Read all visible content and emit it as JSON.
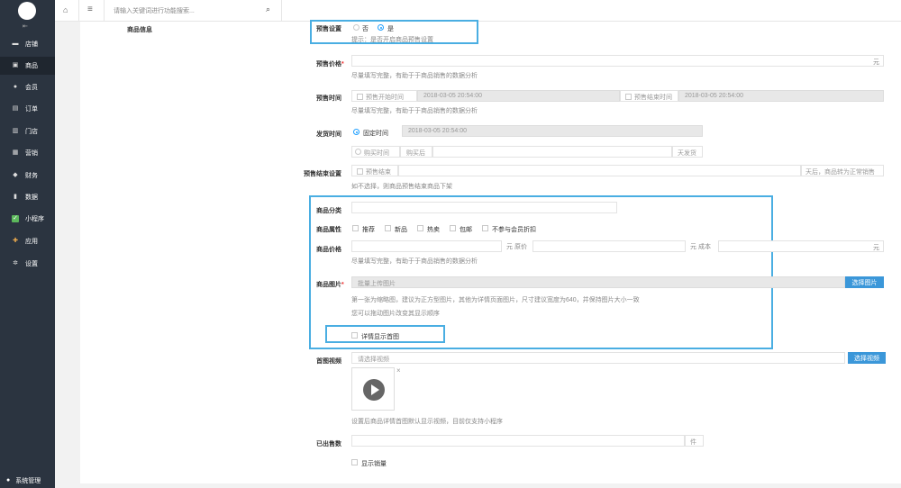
{
  "sidebar": {
    "collapse_glyph": "⇤",
    "items": [
      {
        "label": "店铺",
        "icon": "store-icon"
      },
      {
        "label": "商品",
        "icon": "goods-icon"
      },
      {
        "label": "会员",
        "icon": "member-icon"
      },
      {
        "label": "订单",
        "icon": "order-icon"
      },
      {
        "label": "门店",
        "icon": "shop-icon"
      },
      {
        "label": "营销",
        "icon": "marketing-icon"
      },
      {
        "label": "财务",
        "icon": "finance-icon"
      },
      {
        "label": "数据",
        "icon": "data-icon"
      },
      {
        "label": "小程序",
        "icon": "miniprogram-icon"
      },
      {
        "label": "应用",
        "icon": "apps-icon"
      },
      {
        "label": "设置",
        "icon": "gear-icon"
      }
    ],
    "system_label": "系统管理"
  },
  "topbar": {
    "search_placeholder": "请输入关键词进行功能搜索..."
  },
  "form": {
    "section_label": "商品信息",
    "presale": {
      "label": "预售设置",
      "opt_no": "否",
      "opt_yes": "是",
      "hint": "提示：是否开启商品预售设置"
    },
    "presale_price": {
      "label": "预售价格",
      "suffix": "元",
      "hint": "尽量填写完整，有助于于商品销售的数据分析"
    },
    "presale_time": {
      "label": "预售时间",
      "start_label": "预售开始时间",
      "start_value": "2018-03-05 20:54:00",
      "end_label": "预售结束时间",
      "end_value": "2018-03-05 20:54:00",
      "hint": "尽量填写完整，有助于于商品销售的数据分析"
    },
    "ship_time": {
      "label": "发货时间",
      "fixed_label": "固定时间",
      "fixed_value": "2018-03-05 20:54:00",
      "after_label": "购买时间",
      "after_prefix": "购买后",
      "after_suffix": "天发货"
    },
    "presale_end": {
      "label": "预售结束设置",
      "check_label": "预售结束",
      "suffix": "天后，商品转为正常销售",
      "hint": "如不选择，则商品预售结束商品下架"
    },
    "category": {
      "label": "商品分类"
    },
    "attributes": {
      "label": "商品属性",
      "options": [
        "推荐",
        "新品",
        "热卖",
        "包邮",
        "不参与会员折扣"
      ]
    },
    "price": {
      "label": "商品价格",
      "orig_prefix": "元 原价",
      "cost_prefix": "元 成本",
      "suffix": "元",
      "hint": "尽量填写完整，有助于于商品销售的数据分析"
    },
    "images": {
      "label": "商品图片",
      "placeholder": "批量上传图片",
      "button": "选择图片",
      "hint1": "第一张为缩略图，建议为正方型图片，其他为详情页面图片，尺寸建议宽度为640，并保持图片大小一致",
      "hint2": "您可以拖动图片改变其显示顺序",
      "detail_first": "详情显示首图"
    },
    "video": {
      "label": "首图视频",
      "placeholder": "请选择视频",
      "button": "选择视频",
      "close": "×",
      "hint": "设置后商品详情首图默认显示视频，目前仅支持小程序"
    },
    "sold": {
      "label": "已出售数",
      "suffix": "件",
      "show_label": "显示销量"
    }
  },
  "colors": {
    "sidebar_bg": "#2b3440",
    "accent": "#3b97d9",
    "highlight": "#4aaee2"
  }
}
